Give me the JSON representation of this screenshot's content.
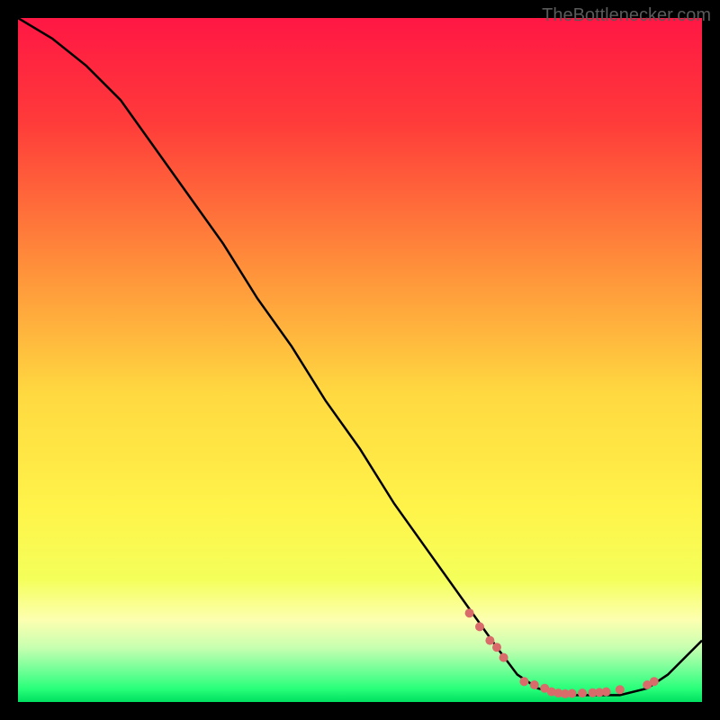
{
  "watermark": "TheBottlenecker.com",
  "chart_data": {
    "type": "line",
    "title": "",
    "xlabel": "",
    "ylabel": "",
    "xlim": [
      0,
      100
    ],
    "ylim": [
      0,
      100
    ],
    "series": [
      {
        "name": "curve",
        "x": [
          0,
          5,
          10,
          15,
          20,
          25,
          30,
          35,
          40,
          45,
          50,
          55,
          60,
          65,
          70,
          73,
          76,
          80,
          84,
          88,
          92,
          95,
          100
        ],
        "y": [
          100,
          97,
          93,
          88,
          81,
          74,
          67,
          59,
          52,
          44,
          37,
          29,
          22,
          15,
          8,
          4,
          2,
          1,
          1,
          1,
          2,
          4,
          9
        ]
      }
    ],
    "markers": {
      "name": "dots",
      "color": "#d96b6b",
      "x": [
        66,
        67.5,
        69,
        70,
        71,
        74,
        75.5,
        77,
        78,
        79,
        80,
        81,
        82.5,
        84,
        85,
        86,
        88,
        92,
        93
      ],
      "y": [
        13,
        11,
        9,
        8,
        6.5,
        3,
        2.5,
        2,
        1.5,
        1.3,
        1.2,
        1.25,
        1.3,
        1.35,
        1.4,
        1.5,
        1.8,
        2.5,
        3
      ]
    },
    "background": {
      "type": "vertical-gradient",
      "stops": [
        {
          "pos": 0.0,
          "color": "#ff1744"
        },
        {
          "pos": 0.15,
          "color": "#ff3a3a"
        },
        {
          "pos": 0.35,
          "color": "#ff8a3a"
        },
        {
          "pos": 0.55,
          "color": "#ffd940"
        },
        {
          "pos": 0.72,
          "color": "#fff44a"
        },
        {
          "pos": 0.82,
          "color": "#f4ff5a"
        },
        {
          "pos": 0.88,
          "color": "#fdffb0"
        },
        {
          "pos": 0.92,
          "color": "#c8ffb0"
        },
        {
          "pos": 0.95,
          "color": "#7aff9a"
        },
        {
          "pos": 0.98,
          "color": "#2aff7a"
        },
        {
          "pos": 1.0,
          "color": "#00e060"
        }
      ]
    }
  }
}
